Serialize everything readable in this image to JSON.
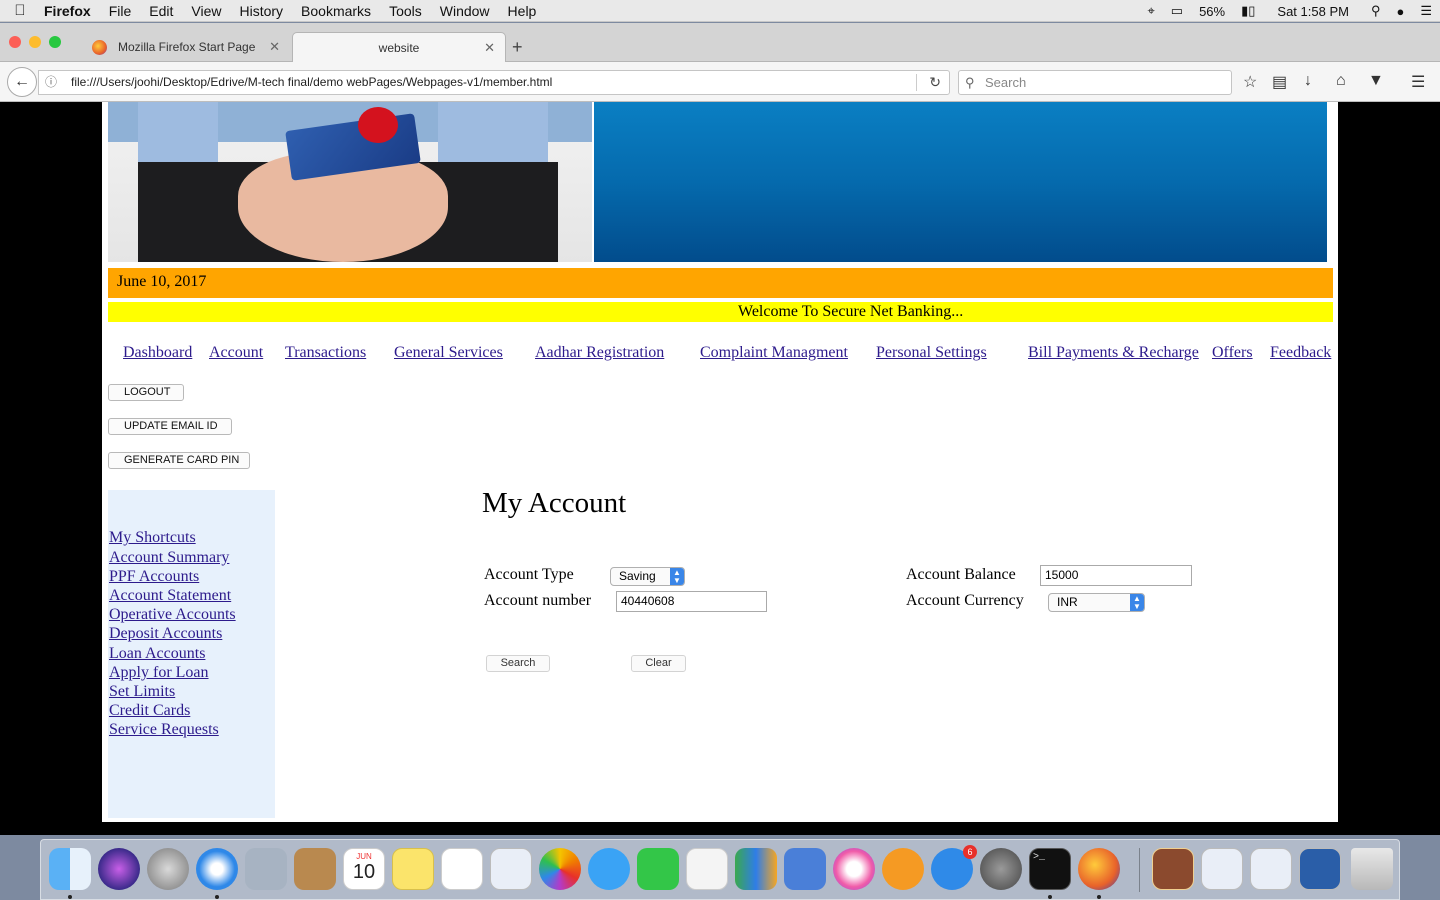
{
  "menubar": {
    "app": "Firefox",
    "items": [
      "File",
      "Edit",
      "View",
      "History",
      "Bookmarks",
      "Tools",
      "Window",
      "Help"
    ],
    "battery": "56%",
    "clock": "Sat 1:58 PM"
  },
  "tabs": [
    {
      "title": "Mozilla Firefox Start Page"
    },
    {
      "title": "website"
    }
  ],
  "navbar": {
    "url": "file:///Users/joohi/Desktop/Edrive/M-tech final/demo webPages/Webpages-v1/member.html",
    "search_placeholder": "Search"
  },
  "page": {
    "date": "June 10, 2017",
    "welcome": "Welcome To Secure Net Banking...",
    "nav": [
      "Dashboard",
      "Account",
      "Transactions",
      "General Services",
      "Aadhar Registration",
      "Complaint Managment",
      "Personal Settings",
      "Bill Payments & Recharge",
      "Offers",
      "Feedback"
    ],
    "buttons": {
      "logout": "LOGOUT",
      "update_email": "UPDATE EMAIL ID",
      "generate_pin": "GENERATE CARD PIN"
    },
    "sidebar": [
      "My Shortcuts",
      "Account Summary",
      "PPF Accounts",
      "Account Statement",
      "Operative Accounts",
      "Deposit Accounts",
      "Loan Accounts",
      "Apply for Loan",
      "Set Limits",
      "Credit Cards",
      "Service Requests"
    ],
    "heading": "My Account",
    "form": {
      "account_type_label": "Account Type",
      "account_type_value": "Saving",
      "account_number_label": "Account number",
      "account_number_value": "40440608",
      "account_balance_label": "Account Balance",
      "account_balance_value": "15000",
      "account_currency_label": "Account Currency",
      "account_currency_value": "INR",
      "search_button": "Search",
      "clear_button": "Clear"
    }
  },
  "dock": {
    "appstore_badge": "6",
    "calendar_month": "JUN",
    "calendar_day": "10"
  }
}
